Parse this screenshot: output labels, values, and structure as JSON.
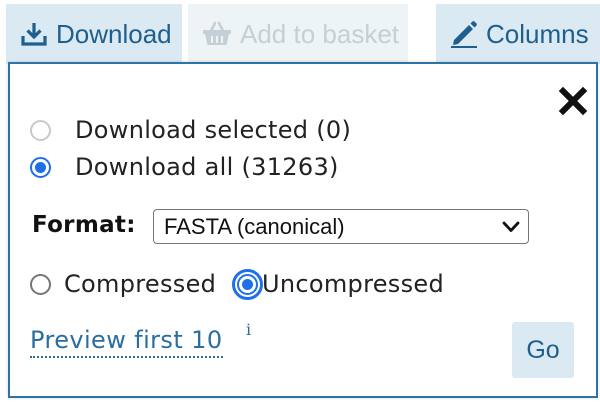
{
  "toolbar": {
    "download": {
      "label": "Download",
      "icon": "download-icon"
    },
    "add_to_basket": {
      "label": "Add to basket",
      "icon": "basket-icon",
      "disabled": true
    },
    "columns": {
      "label": "Columns",
      "icon": "pencil-icon"
    }
  },
  "popover": {
    "close_icon": "close-icon",
    "scope_options": [
      {
        "label": "Download selected (0)",
        "checked": false,
        "disabled": true
      },
      {
        "label": "Download all (31263)",
        "checked": true,
        "disabled": false
      }
    ],
    "format": {
      "label": "Format:",
      "selected": "FASTA (canonical)"
    },
    "compression_options": [
      {
        "label": "Compressed",
        "checked": false
      },
      {
        "label": "Uncompressed",
        "checked": true,
        "focused": true
      }
    ],
    "preview_link": "Preview first 10",
    "info_marker": "i",
    "go_label": "Go"
  },
  "colors": {
    "accent": "#1e6fe8",
    "button_bg": "#dbe9f2",
    "button_text": "#1d5f8e",
    "popover_border": "#2d73a6",
    "link": "#2a6ea1"
  }
}
